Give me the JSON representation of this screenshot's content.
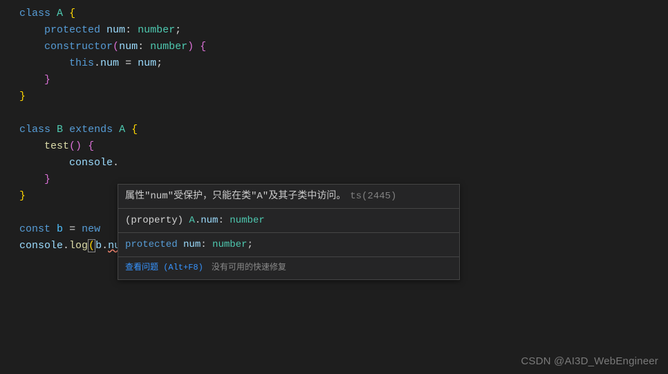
{
  "tokens": {
    "class": "class",
    "A": "A",
    "B": "B",
    "extends": "extends",
    "protected": "protected",
    "num": "num",
    "number": "number",
    "constructor": "constructor",
    "this": "this",
    "test": "test",
    "console": "console",
    "const": "const",
    "b": "b",
    "new": "new",
    "log": "log",
    "colon": ":",
    "semi": ";",
    "lbrace": "{",
    "rbrace": "}",
    "lparen": "(",
    "rparen": ")",
    "eq": "=",
    "dot": "."
  },
  "hover": {
    "error_text": "属性\"num\"受保护，只能在类\"A\"及其子类中访问。",
    "error_code": "ts(2445)",
    "signature_pre": "(property) ",
    "signature_class": "A",
    "signature_dot": ".",
    "signature_prop": "num",
    "signature_colon": ": ",
    "signature_type": "number",
    "decl_protected": "protected",
    "decl_prop": " num",
    "decl_colon": ": ",
    "decl_type": "number",
    "decl_semi": ";",
    "view_problem": "查看问题 (Alt+F8)",
    "no_fix": "没有可用的快速修复"
  },
  "watermark": "CSDN @AI3D_WebEngineer"
}
